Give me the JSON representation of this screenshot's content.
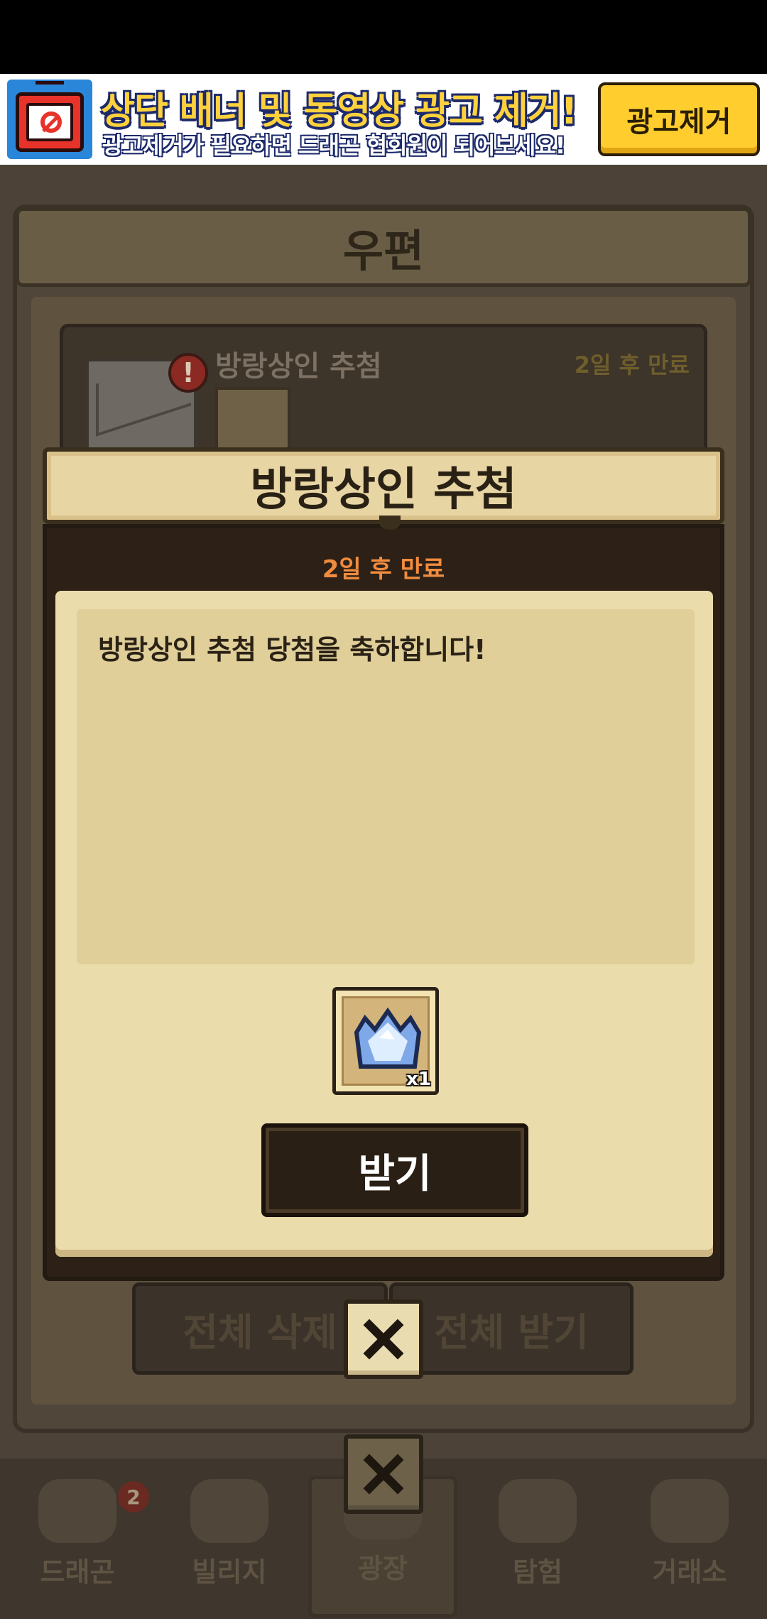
{
  "ad": {
    "title": "상단 배너 및 동영상 광고 제거!",
    "subtitle": "광고제거가 필요하면 드래곤 협회원이 되어보세요!",
    "button_label": "광고제거",
    "icon": "no-ads-tv-icon"
  },
  "mailbox": {
    "title": "우편",
    "item": {
      "title": "방랑상인 추첨",
      "expiry": "2일 후 만료",
      "alert_icon": "!"
    },
    "delete_all_label": "전체 삭제",
    "receive_all_label": "전체 받기"
  },
  "dialog": {
    "title": "방랑상인 추첨",
    "expiry": "2일 후 만료",
    "message": "방랑상인 추첨 당첨을 축하합니다!",
    "reward": {
      "icon": "crystal-crown-icon",
      "quantity": "x1"
    },
    "receive_label": "받기",
    "close_icon": "close-icon"
  },
  "tabs": [
    {
      "label": "드래곤",
      "badge": "2",
      "icon": "dragon-icon"
    },
    {
      "label": "빌리지",
      "icon": "village-icon"
    },
    {
      "label": "광장",
      "icon": "plaza-icon",
      "active": true
    },
    {
      "label": "탐험",
      "icon": "compass-icon"
    },
    {
      "label": "거래소",
      "icon": "scales-icon"
    }
  ],
  "colors": {
    "expiry_accent": "#f18c3e",
    "dialog_paper": "#eadcab",
    "button_dark": "#2a1f14",
    "ad_button": "#ffce2e"
  }
}
